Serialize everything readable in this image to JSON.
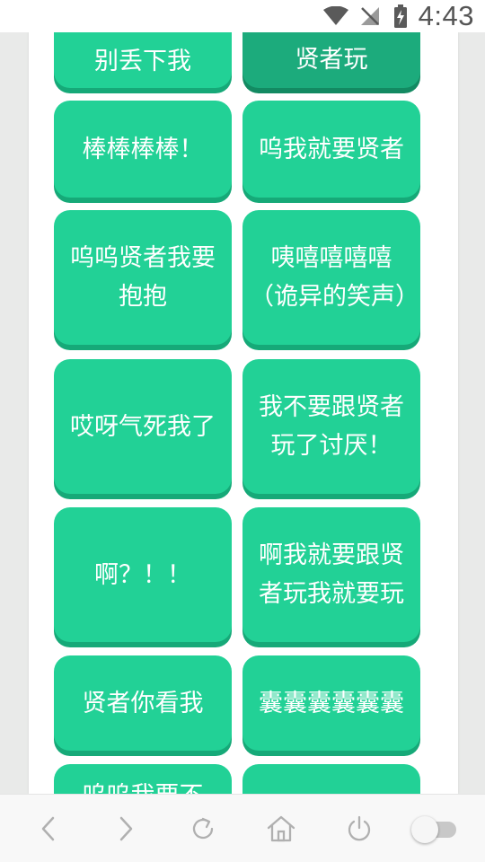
{
  "status_bar": {
    "time": "4:43"
  },
  "buttons": [
    {
      "label": "别丢下我",
      "active": false
    },
    {
      "label": "贤者玩",
      "active": true
    },
    {
      "label": "棒棒棒棒！",
      "active": false
    },
    {
      "label": "呜我就要贤者",
      "active": false
    },
    {
      "label": "呜呜贤者我要抱抱",
      "active": false
    },
    {
      "label": "咦嘻嘻嘻嘻（诡异的笑声）",
      "active": false
    },
    {
      "label": "哎呀气死我了",
      "active": false
    },
    {
      "label": "我不要跟贤者玩了讨厌！",
      "active": false
    },
    {
      "label": "啊？！！",
      "active": false
    },
    {
      "label": "啊我就要跟贤者玩我就要玩",
      "active": false
    },
    {
      "label": "贤者你看我",
      "active": false
    },
    {
      "label": "囊囊囊囊囊囊",
      "active": false
    },
    {
      "label": "呜呜我要不",
      "active": false
    },
    {
      "label": "",
      "active": false
    }
  ],
  "bottom_nav": {
    "icons": [
      "back-icon",
      "forward-icon",
      "refresh-icon",
      "home-icon",
      "power-icon"
    ],
    "toggle_on": false
  },
  "colors": {
    "button": "#22d196",
    "button_shadow": "#16a978",
    "button_active": "#1cab7c"
  }
}
